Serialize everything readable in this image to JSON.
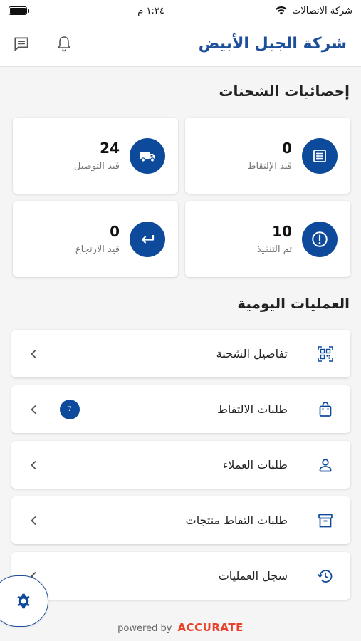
{
  "status_bar": {
    "carrier": "شركة الاتصالات",
    "time": "١:٣٤ م"
  },
  "header": {
    "title": "شركة الجبل الأبيض",
    "icons": [
      "chat-icon",
      "bell-icon"
    ]
  },
  "stats": {
    "title": "إحصائيات الشحنات",
    "cards": [
      {
        "value": "0",
        "label": "قيد الإلتقاط",
        "icon": "list-icon"
      },
      {
        "value": "24",
        "label": "قيد التوصيل",
        "icon": "truck-icon"
      },
      {
        "value": "10",
        "label": "تم التنفيذ",
        "icon": "exclamation-icon"
      },
      {
        "value": "0",
        "label": "قيد الارتجاع",
        "icon": "return-arrow-icon"
      }
    ]
  },
  "operations": {
    "title": "العمليات اليومية",
    "items": [
      {
        "label": "تفاصيل الشحنة",
        "icon": "qr-code-icon",
        "badge": ""
      },
      {
        "label": "طلبات الالتقاط",
        "icon": "bag-icon",
        "badge": "7"
      },
      {
        "label": "طلبات العملاء",
        "icon": "person-icon",
        "badge": ""
      },
      {
        "label": "طلبات التقاط منتجات",
        "icon": "archive-icon",
        "badge": ""
      },
      {
        "label": "سجل العمليات",
        "icon": "history-icon",
        "badge": ""
      }
    ]
  },
  "footer": {
    "powered_by": "powered by",
    "brand": "ACCURATE"
  },
  "colors": {
    "accent": "#0e4a9c",
    "title": "#1d4f9a",
    "brand": "#e8412c"
  }
}
